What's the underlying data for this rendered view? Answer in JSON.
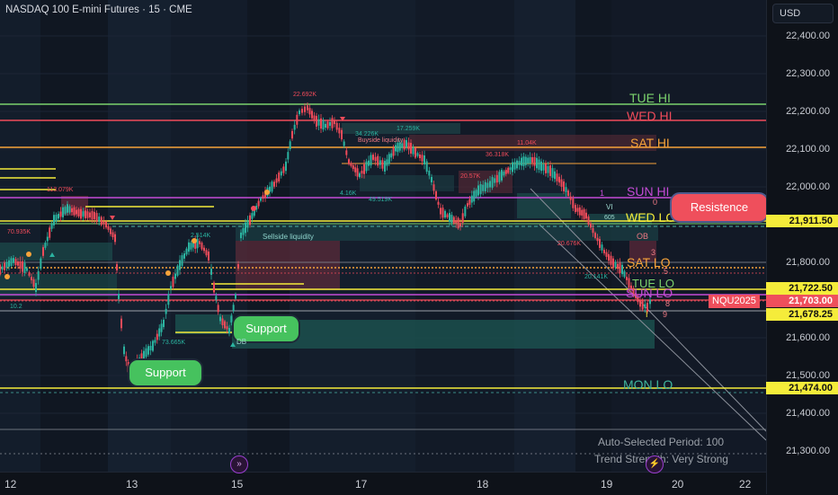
{
  "header": {
    "symbol_title": "NASDAQ 100 E-mini Futures · 15 · CME",
    "currency": "USD"
  },
  "price_axis": {
    "ticks": [
      "22,400.00",
      "22,300.00",
      "22,200.00",
      "22,100.00",
      "22,000.00",
      "21,800.00",
      "21,600.00",
      "21,500.00",
      "21,400.00",
      "21,300.00"
    ],
    "tags": {
      "t1": "21,911.50",
      "t2": "21,722.50",
      "symbol": "NQU2025",
      "t3": "21,703.00",
      "t4": "21,678.25",
      "t5": "21,474.00"
    }
  },
  "time_axis": {
    "labels": [
      "12",
      "13",
      "15",
      "17",
      "18",
      "19",
      "20",
      "22"
    ]
  },
  "levels": {
    "tue_hi": "TUE HI",
    "wed_hi": "WED HI",
    "sat_hi": "SAT HI",
    "sun_hi": "SUN HI",
    "wed_lo": "WED LO",
    "sat_lo": "SAT LO",
    "sun_lo": "SUN LO",
    "tue_lo": "TUE LO",
    "mon_lo": "MON LO"
  },
  "annotations": {
    "support1": "Support",
    "support2": "Support",
    "resistance": "Resistence",
    "sellside": "Sellside liquidity",
    "buyside": "Buyside liquidity"
  },
  "volume_labels": [
    "22.692K",
    "34.226K",
    "17.259K",
    "11.04K",
    "36.318K",
    "20.57K",
    "113.079K",
    "70.935K",
    "2.514K",
    "73.665K",
    "49.519K",
    "4.16K",
    "20.676K",
    "20.141K",
    "10.2"
  ],
  "footer": {
    "period": "Auto-Selected Period: 100",
    "trend": "Trend Strength: Very Strong"
  },
  "small_marks": [
    "0",
    "1",
    "3",
    "5",
    "8",
    "9",
    "OB",
    "VI",
    "DB",
    "605"
  ],
  "colors": {
    "green_line": "#7bd26d",
    "red_line": "#ef4b5a",
    "orange_line": "#f7a33a",
    "yellow_line": "#f5ec3a",
    "purple_line": "#c44bd6",
    "teal_box": "#1f6b63",
    "red_box": "#6b2a36",
    "up_candle": "#2bb3a0",
    "down_candle": "#ef4b5a",
    "support_pill": "#46c25e",
    "resistance_pill": "#ef4f5c",
    "current_price_tag": "#ef4f5c"
  },
  "icons": {
    "session_icon": "double-chevron-icon",
    "alert_icon": "lightning-icon"
  }
}
